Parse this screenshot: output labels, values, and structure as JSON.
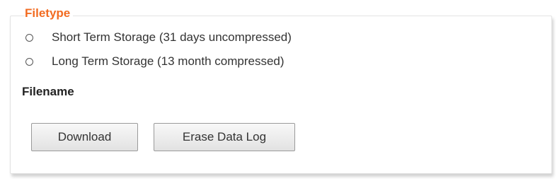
{
  "fieldset": {
    "legend": "Filetype"
  },
  "filetype_options": [
    {
      "label": "Short Term Storage (31 days uncompressed)",
      "selected": false
    },
    {
      "label": "Long Term Storage (13 month compressed)",
      "selected": false
    }
  ],
  "filename_label": "Filename",
  "buttons": {
    "download": "Download",
    "erase": "Erase Data Log"
  },
  "colors": {
    "legend": "#f26b21",
    "button_border": "#9a9a9a",
    "panel_border": "#e3e3e3"
  }
}
